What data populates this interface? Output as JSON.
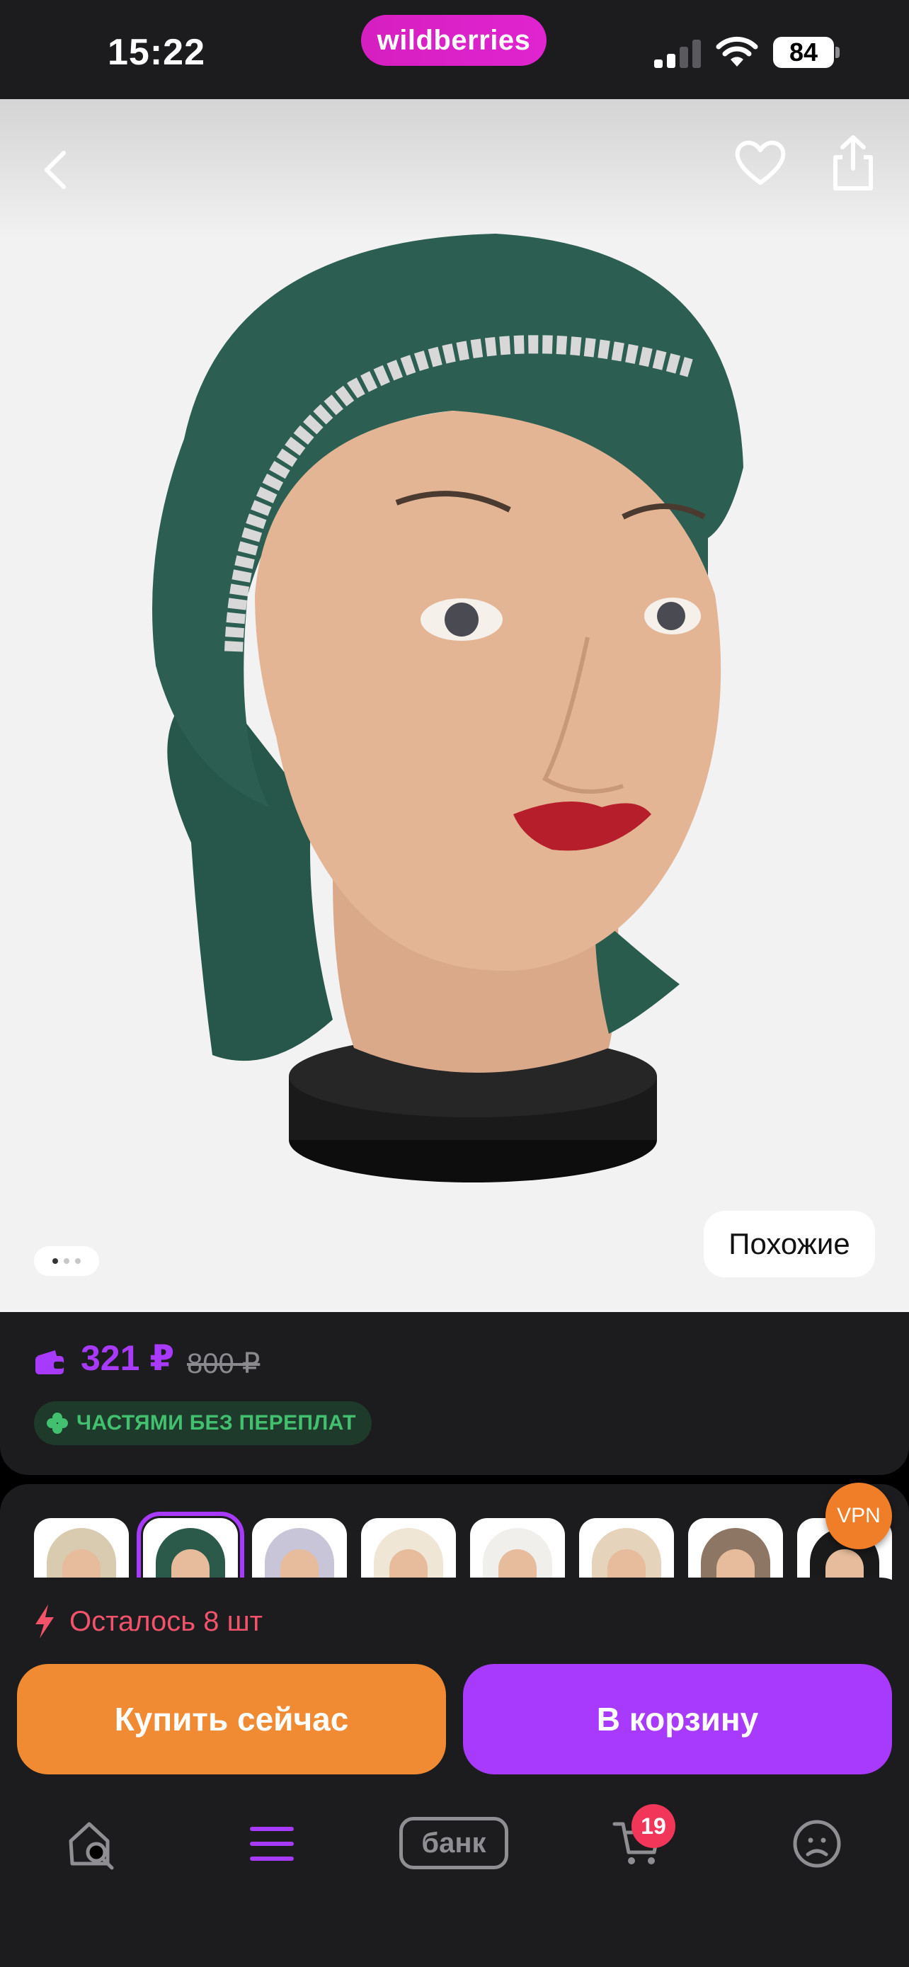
{
  "status_bar": {
    "time": "15:22",
    "brand": "wildberries",
    "battery": "84"
  },
  "product_view": {
    "similar_label": "Похожие",
    "page_indicator": {
      "count": 3,
      "active": 1
    }
  },
  "price": {
    "current": "321 ₽",
    "old": "800 ₽",
    "installments": "ЧАСТЯМИ БЕЗ ПЕРЕПЛАТ"
  },
  "variants": [
    {
      "name": "variant-beige-pattern",
      "scarf_color": "#d9cbb0"
    },
    {
      "name": "variant-green-lace",
      "scarf_color": "#2b5a4a",
      "selected": true
    },
    {
      "name": "variant-lavender-lace",
      "scarf_color": "#c9c5d8"
    },
    {
      "name": "variant-cream",
      "scarf_color": "#efe6d6"
    },
    {
      "name": "variant-white-lace",
      "scarf_color": "#f0efec"
    },
    {
      "name": "variant-beige",
      "scarf_color": "#e5d3bb"
    },
    {
      "name": "variant-taupe",
      "scarf_color": "#8d7663"
    },
    {
      "name": "variant-black",
      "scarf_color": "#1a1a1a"
    }
  ],
  "vpn_badge": "VPN",
  "stock": {
    "text": "Осталось 8 шт"
  },
  "actions": {
    "buy_now": "Купить сейчас",
    "add_to_cart": "В корзину"
  },
  "tab_bar": {
    "bank_label": "банк",
    "cart_count": "19"
  },
  "colors": {
    "accent": "#a73afd",
    "buy_now": "#f08a33",
    "stock": "#f2536b",
    "installments": "#42c06f"
  }
}
